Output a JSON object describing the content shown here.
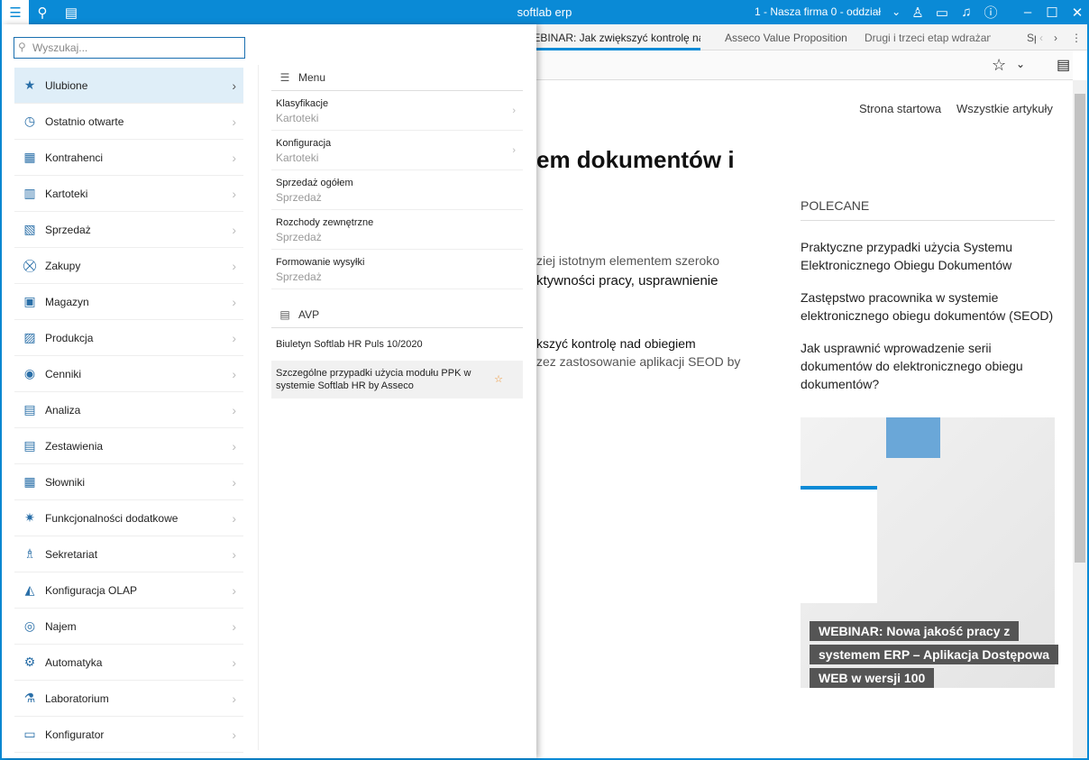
{
  "titlebar": {
    "title": "softlab erp",
    "company": "1 - Nasza firma 0 - oddział"
  },
  "tabs": [
    "WEBINAR: Jak zwiększyć kontrolę nad",
    "Asseco Value Proposition",
    "Drugi i trzeci etap wdrażania PI",
    "Sp"
  ],
  "article": {
    "nav": [
      "Strona startowa",
      "Wszystkie artykuły"
    ],
    "heading": "em dokumentów i",
    "p1": "ziej istotnym elementem szeroko",
    "p2": "ktywności pracy, usprawnienie",
    "p3": "kszyć kontrolę nad obiegiem",
    "p4": "zez zastosowanie aplikacji SEOD by",
    "recommended_title": "POLECANE",
    "recommended": [
      "Praktyczne przypadki użycia Systemu Elektronicznego Obiegu Dokumentów",
      "Zastępstwo pracownika w systemie elektronicznego obiegu dokumentów (SEOD)",
      "Jak usprawnić wprowadzenie serii dokumentów do elektronicznego obiegu dokumentów?"
    ],
    "caption": "WEBINAR: Nowa jakość pracy z systemem ERP – Aplikacja Dostępowa WEB w wersji 100"
  },
  "panel": {
    "search_placeholder": "Wyszukaj...",
    "nav": [
      "Ulubione",
      "Ostatnio otwarte",
      "Kontrahenci",
      "Kartoteki",
      "Sprzedaż",
      "Zakupy",
      "Magazyn",
      "Produkcja",
      "Cenniki",
      "Analiza",
      "Zestawienia",
      "Słowniki",
      "Funkcjonalności dodatkowe",
      "Sekretariat",
      "Konfiguracja OLAP",
      "Najem",
      "Automatyka",
      "Laboratorium",
      "Konfigurator"
    ],
    "menu_title": "Menu",
    "menu": [
      {
        "title": "Klasyfikacje",
        "sub": "Kartoteki"
      },
      {
        "title": "Konfiguracja",
        "sub": "Kartoteki"
      },
      {
        "title": "Sprzedaż ogółem",
        "sub": "Sprzedaż"
      },
      {
        "title": "Rozchody zewnętrzne",
        "sub": "Sprzedaż"
      },
      {
        "title": "Formowanie wysyłki",
        "sub": "Sprzedaż"
      }
    ],
    "avp_title": "AVP",
    "avp": [
      "Biuletyn Softlab HR Puls 10/2020",
      "Szczególne przypadki użycia modułu PPK w systemie Softlab HR by Asseco"
    ]
  },
  "colors": {
    "accent": "#0a8ad6",
    "selected": "#dfeef8",
    "star": "#f0922e"
  }
}
